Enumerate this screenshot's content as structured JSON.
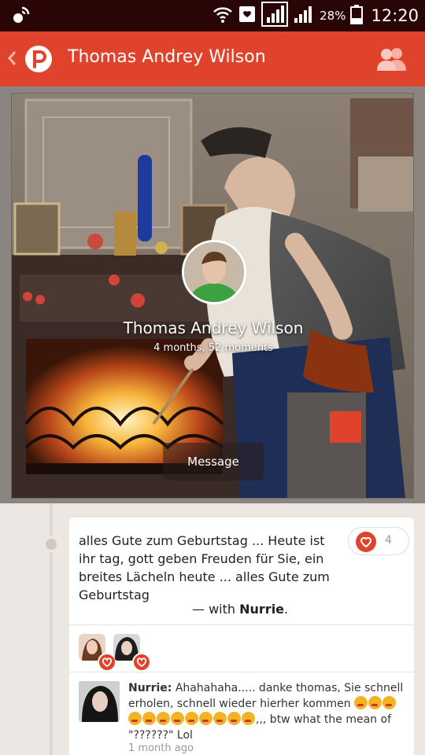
{
  "status_bar": {
    "battery_percent": "28%",
    "time": "12:20",
    "icons": [
      "satellite-notification-icon",
      "wifi-icon",
      "message-notification-icon",
      "signal-icon",
      "signal-icon",
      "battery-icon"
    ]
  },
  "action_bar": {
    "title": "Thomas Andrey Wilson",
    "background": "#e0432b",
    "icons": [
      "back-chevron-icon",
      "path-logo-icon",
      "friends-icon"
    ]
  },
  "profile": {
    "name": "Thomas Andrey Wilson",
    "subtitle": "4 months, 52 moments",
    "message_button": "Message"
  },
  "moment": {
    "text": "alles Gute zum Geburtstag ... Heute ist ihr tag, gott geben Freuden für Sie, ein breites Lächeln heute ... alles Gute zum Geburtstag",
    "with_prefix": "— with ",
    "with_name": "Nurrie",
    "with_suffix": ".",
    "like_count": "4",
    "comment": {
      "author": "Nurrie:",
      "text_start": " Ahahahaha..... danke thomas, Sie schnell erholen, schnell wieder hierher kommen ",
      "emoji_count": 12,
      "text_end": ",,, btw what the mean of \"??????\" Lol",
      "time": "1 month ago"
    }
  }
}
